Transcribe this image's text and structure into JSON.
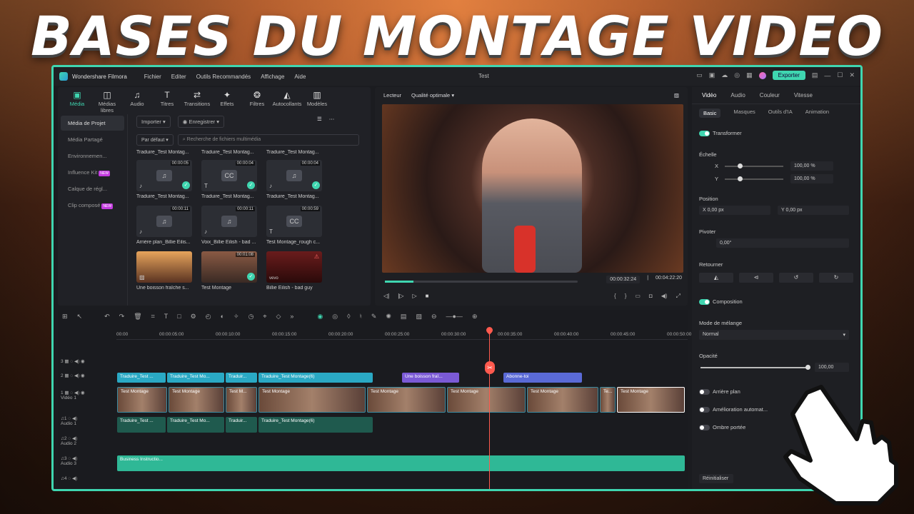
{
  "headline": "BASES DU MONTAGE VIDEO",
  "titlebar": {
    "app_name": "Wondershare Filmora",
    "menu": [
      "Fichier",
      "Editer",
      "Outils Recommandés",
      "Affichage",
      "Aide"
    ],
    "window_title": "Test",
    "export_label": "Exporter"
  },
  "media": {
    "tabs": [
      {
        "label": "Média",
        "icon": "media-icon"
      },
      {
        "label": "Médias libres",
        "icon": "stock-media-icon"
      },
      {
        "label": "Audio",
        "icon": "music-note-icon"
      },
      {
        "label": "Titres",
        "icon": "title-t-icon"
      },
      {
        "label": "Transitions",
        "icon": "transitions-icon"
      },
      {
        "label": "Effets",
        "icon": "effects-star-icon"
      },
      {
        "label": "Filtres",
        "icon": "filters-icon"
      },
      {
        "label": "Autocollants",
        "icon": "stickers-icon"
      },
      {
        "label": "Modèles",
        "icon": "templates-icon"
      }
    ],
    "sidebar": [
      {
        "label": "Média de Projet"
      },
      {
        "label": "Média Partagé"
      },
      {
        "label": "Environnemen..."
      },
      {
        "label": "Influence Kit",
        "badge": "NEW"
      },
      {
        "label": "Calque de régl..."
      },
      {
        "label": "Clip composé",
        "badge": "NEW"
      }
    ],
    "import_label": "Importer",
    "record_label": "Enregistrer",
    "sort_label": "Par défaut",
    "search_placeholder": "Recherche de fichiers multimédia",
    "top_captions": [
      "Traduire_Test Montag...",
      "Traduire_Test Montag...",
      "Traduire_Test Montag..."
    ],
    "items": [
      {
        "duration": "00:00:05",
        "caption": "Traduire_Test Montag...",
        "type": "audio",
        "check": true
      },
      {
        "duration": "00:00:04",
        "caption": "Traduire_Test Montag...",
        "type": "cc",
        "check": true
      },
      {
        "duration": "00:00:04",
        "caption": "Traduire_Test Montag...",
        "type": "audio",
        "check": true
      },
      {
        "duration": "00:00:11",
        "caption": "Arrière plan_Billie Eilis...",
        "type": "audio",
        "check": false
      },
      {
        "duration": "00:00:11",
        "caption": "Voix_Billie Eilish - bad ...",
        "type": "audio",
        "check": false
      },
      {
        "duration": "00:00:59",
        "caption": "Test Montage_rough c...",
        "type": "cc",
        "check": false
      },
      {
        "duration": "",
        "caption": "Une boisson fraîche s...",
        "type": "image",
        "check": false
      },
      {
        "duration": "00:01:08",
        "caption": "Test Montage",
        "type": "video",
        "check": true
      },
      {
        "duration": "",
        "caption": "Billie Eilish - bad guy",
        "type": "vevo",
        "check": false,
        "tag": "vevo"
      }
    ]
  },
  "preview": {
    "player_label": "Lecteur",
    "quality_label": "Qualité optimale",
    "current_time": "00:00:32:24",
    "total_time": "00:04:22:20"
  },
  "props": {
    "tabs": [
      "Vidéo",
      "Audio",
      "Couleur",
      "Vitesse"
    ],
    "subtabs": [
      "Basic",
      "Masques",
      "Outils d'IA",
      "Animation"
    ],
    "transformer": "Transformer",
    "echelle": "Échelle",
    "x_label": "X",
    "y_label": "Y",
    "scale_x": "100,00",
    "scale_y": "100,00",
    "pct": "%",
    "position": "Position",
    "pos_x": "0,00",
    "pos_y": "0,00",
    "px": "px",
    "pivoter": "Pivoter",
    "rotation": "0,00°",
    "retourner": "Retourner",
    "composition": "Composition",
    "blend_mode": "Mode de mélange",
    "blend_value": "Normal",
    "opacity_label": "Opacité",
    "opacity_value": "100,00",
    "opacity_level": 1.0,
    "background": "Arrière plan",
    "enhance": "Amélioration automat...",
    "shadow": "Ombre portée",
    "reset": "Réinitialiser"
  },
  "timeline": {
    "ruler": [
      "00:00",
      "00:00:05:00",
      "00:00:10:00",
      "00:00:15:00",
      "00:00:20:00",
      "00:00:25:00",
      "00:00:30:00",
      "00:00:35:00",
      "00:00:40:00",
      "00:00:45:00",
      "00:00:50:00"
    ],
    "title_clips": [
      "Traduire_Test ...",
      "Traduire_Test Mo...",
      "Traduir...",
      "Traduire_Test Montage(6)"
    ],
    "image_clip": "Une boisson fraî...",
    "subscribe_clip": "Abonne-toi",
    "video_clips": [
      "Test Montage",
      "Test Montage",
      "Test M...",
      "Test Montage",
      "Test Montage",
      "Test Montage",
      "Test Montage",
      "Te...",
      "Test Montage"
    ],
    "audio1_clips": [
      "Traduire_Test ...",
      "Traduire_Test Mo...",
      "Traduir...",
      "Traduire_Test Montage(6)"
    ],
    "audio3_clip": "Business Instructio...",
    "track_video": "Vidéo 1",
    "track_audio1": "Audio 1",
    "track_audio2": "Audio 2",
    "track_audio3": "Audio 3",
    "track_nums": [
      "3",
      "2",
      "1",
      "1",
      "2",
      "3",
      "4"
    ]
  },
  "colors": {
    "accent": "#3fd6b0",
    "playhead": "#ff5a4e",
    "title_clip": "#2aa9c4",
    "purple_clip": "#7b5ad6"
  }
}
